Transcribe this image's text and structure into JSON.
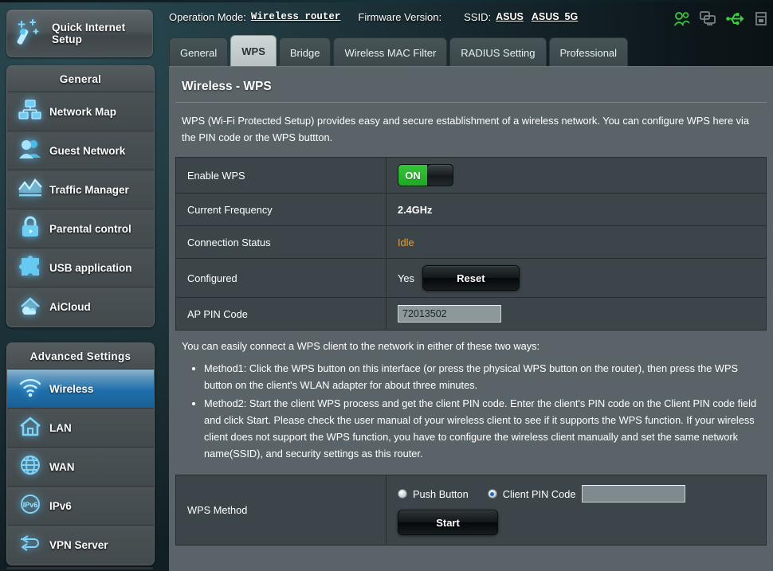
{
  "header": {
    "operation_mode_label": "Operation Mode:",
    "operation_mode_value": "Wireless router",
    "firmware_label": "Firmware Version:",
    "firmware_value": "",
    "ssid_label": "SSID:",
    "ssid_value_1": "ASUS",
    "ssid_value_2": "ASUS_5G",
    "icons": [
      "clients-icon",
      "display-icon",
      "usb-icon",
      "printer-icon"
    ],
    "accent_green": "#39d03a",
    "icon_gray": "#7b8589"
  },
  "sidebar": {
    "quick_setup": {
      "label": "Quick Internet Setup",
      "icon": "magic-wand-icon"
    },
    "general_header": "General",
    "general_items": [
      {
        "label": "Network Map",
        "icon": "network-map-icon"
      },
      {
        "label": "Guest Network",
        "icon": "guest-network-icon"
      },
      {
        "label": "Traffic Manager",
        "icon": "traffic-manager-icon"
      },
      {
        "label": "Parental control",
        "icon": "lock-icon"
      },
      {
        "label": "USB application",
        "icon": "puzzle-icon"
      },
      {
        "label": "AiCloud",
        "icon": "aicloud-icon"
      }
    ],
    "advanced_header": "Advanced Settings",
    "advanced_items": [
      {
        "label": "Wireless",
        "icon": "wifi-icon",
        "active": true
      },
      {
        "label": "LAN",
        "icon": "home-icon",
        "active": false
      },
      {
        "label": "WAN",
        "icon": "globe-icon",
        "active": false
      },
      {
        "label": "IPv6",
        "icon": "ipv6-icon",
        "active": false
      },
      {
        "label": "VPN Server",
        "icon": "vpn-icon",
        "active": false
      }
    ]
  },
  "tabs": [
    {
      "label": "General",
      "active": false
    },
    {
      "label": "WPS",
      "active": true
    },
    {
      "label": "Bridge",
      "active": false
    },
    {
      "label": "Wireless MAC Filter",
      "active": false
    },
    {
      "label": "RADIUS Setting",
      "active": false
    },
    {
      "label": "Professional",
      "active": false
    }
  ],
  "page": {
    "title": "Wireless - WPS",
    "intro": "WPS (Wi-Fi Protected Setup) provides easy and secure establishment of a wireless network. You can configure WPS here via the PIN code or the WPS buttton.",
    "settings": [
      {
        "label": "Enable WPS",
        "type": "toggle",
        "value": "ON"
      },
      {
        "label": "Current Frequency",
        "type": "text",
        "value": "2.4GHz"
      },
      {
        "label": "Connection Status",
        "type": "status",
        "value": "Idle",
        "color": "#e0a23c"
      },
      {
        "label": "Configured",
        "type": "configured",
        "value": "Yes",
        "button": "Reset"
      },
      {
        "label": "AP PIN Code",
        "type": "input",
        "value": "72013502"
      }
    ],
    "howto_intro": "You can easily connect a WPS client to the network in either of these two ways:",
    "methods": [
      "Method1: Click the WPS button on this interface (or press the physical WPS button on the router), then press the WPS button on the client's WLAN adapter for about three minutes.",
      "Method2: Start the client WPS process and get the client PIN code. Enter the client's PIN code on the Client PIN code field and click Start. Please check the user manual of your wireless client to see if it supports the WPS function. If your wireless client does not support the WPS function, you have to configure the wireless client manually and set the same network name(SSID), and security settings as this router."
    ],
    "wps_method": {
      "label": "WPS Method",
      "push_button_label": "Push Button",
      "push_button_selected": false,
      "client_pin_label": "Client PIN Code",
      "client_pin_selected": true,
      "client_pin_value": "",
      "start_label": "Start"
    }
  }
}
